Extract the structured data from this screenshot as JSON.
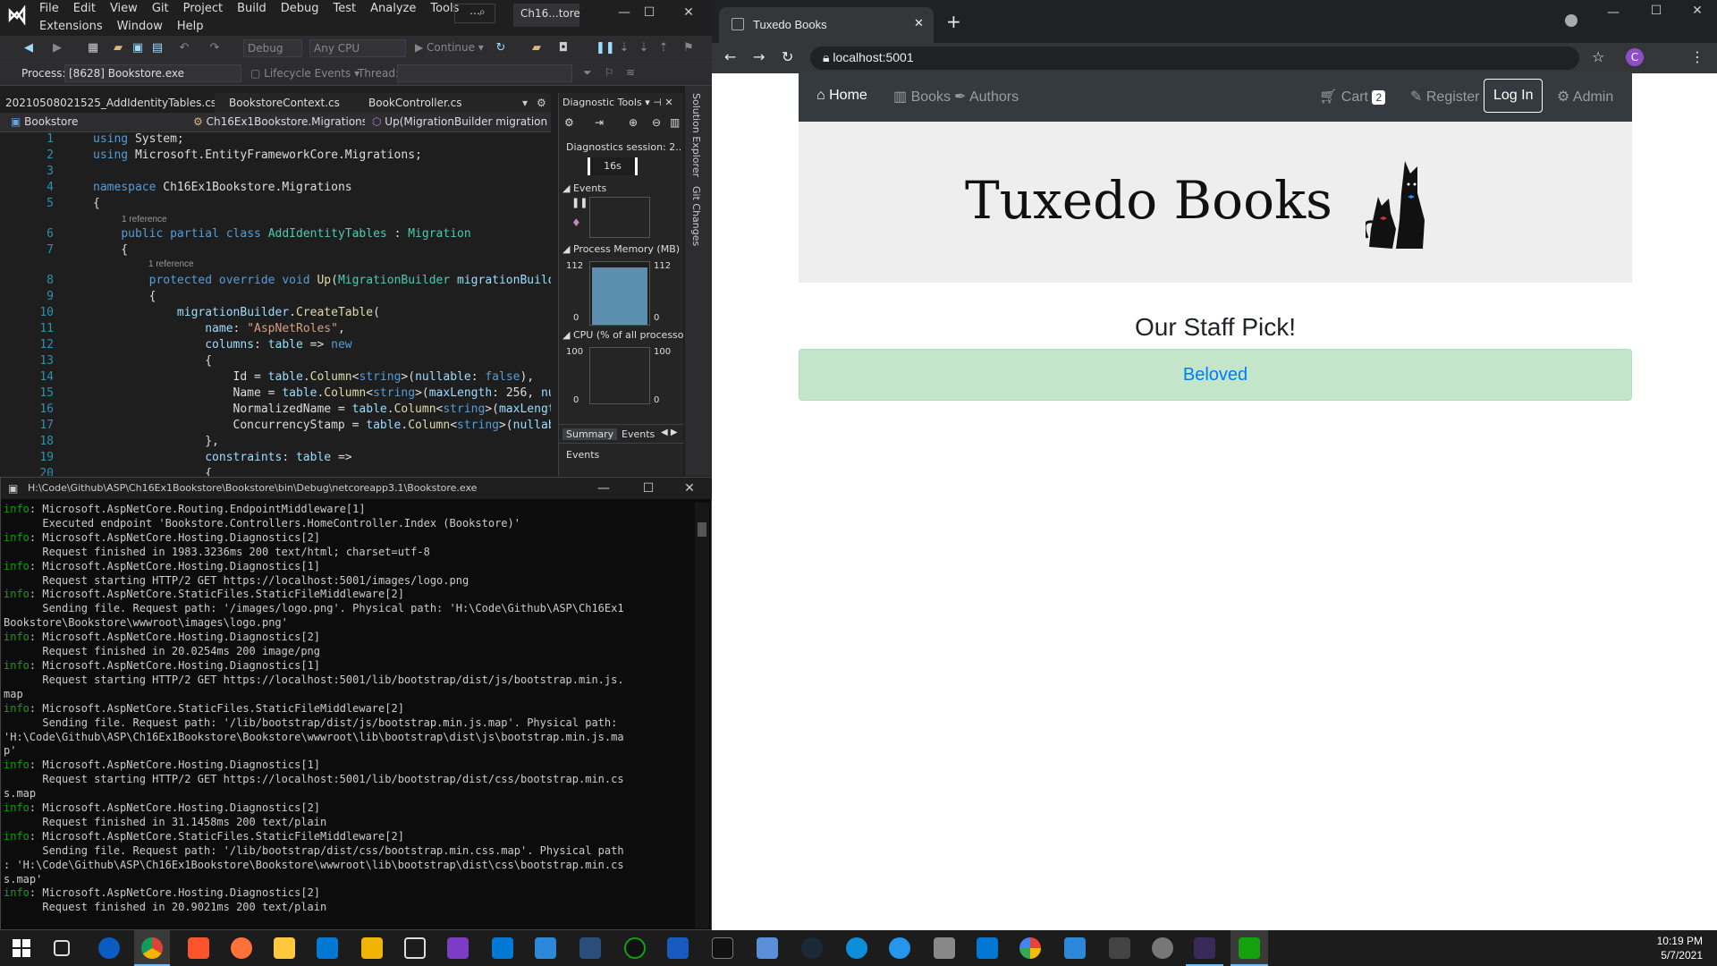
{
  "vs": {
    "menu_row1": [
      "File",
      "Edit",
      "View",
      "Git",
      "Project",
      "Build",
      "Debug",
      "Test",
      "Analyze",
      "Tools"
    ],
    "menu_row2": [
      "Extensions",
      "Window",
      "Help"
    ],
    "title": "Ch16...tore",
    "toolbar": {
      "config": "Debug",
      "platform": "Any CPU",
      "continue": "Continue"
    },
    "process_label": "Process:",
    "process_value": "[8628] Bookstore.exe",
    "lifecycle": "Lifecycle Events",
    "thread_label": "Thread:",
    "tabs": [
      "20210508021525_AddIdentityTables.cs",
      "BookstoreContext.cs",
      "BookController.cs"
    ],
    "nav_project": "Bookstore",
    "nav_class": "Ch16Ex1Bookstore.Migrations.A",
    "nav_member": "Up(MigrationBuilder migrationI",
    "line_numbers": [
      "1",
      "2",
      "3",
      "4",
      "5",
      "6",
      "7",
      "8",
      "9",
      "10",
      "11",
      "12",
      "13",
      "14",
      "15",
      "16",
      "17",
      "18",
      "19",
      "20"
    ],
    "ref_label": "1 reference"
  },
  "diag": {
    "title": "Diagnostic Tools",
    "session": "Diagnostics session: 2...",
    "time": "16s",
    "events": "Events",
    "memory": "Process Memory (MB)",
    "mem_max": "112",
    "mem_min": "0",
    "cpu": "CPU (% of all processo",
    "cpu_max": "100",
    "cpu_min": "0",
    "tab_summary": "Summary",
    "tab_events": "Events",
    "events_footer": "Events"
  },
  "side_tabs": [
    "Solution Explorer",
    "Git Changes"
  ],
  "console": {
    "title": "H:\\Code\\Github\\ASP\\Ch16Ex1Bookstore\\Bookstore\\bin\\Debug\\netcoreapp3.1\\Bookstore.exe",
    "lines": [
      [
        "info",
        ": Microsoft.AspNetCore.Routing.EndpointMiddleware[1]"
      ],
      [
        "",
        "      Executed endpoint 'Bookstore.Controllers.HomeController.Index (Bookstore)'"
      ],
      [
        "info",
        ": Microsoft.AspNetCore.Hosting.Diagnostics[2]"
      ],
      [
        "",
        "      Request finished in 1983.3236ms 200 text/html; charset=utf-8"
      ],
      [
        "info",
        ": Microsoft.AspNetCore.Hosting.Diagnostics[1]"
      ],
      [
        "",
        "      Request starting HTTP/2 GET https://localhost:5001/images/logo.png"
      ],
      [
        "info",
        ": Microsoft.AspNetCore.StaticFiles.StaticFileMiddleware[2]"
      ],
      [
        "",
        "      Sending file. Request path: '/images/logo.png'. Physical path: 'H:\\Code\\Github\\ASP\\Ch16Ex1"
      ],
      [
        "",
        "Bookstore\\Bookstore\\wwwroot\\images\\logo.png'"
      ],
      [
        "info",
        ": Microsoft.AspNetCore.Hosting.Diagnostics[2]"
      ],
      [
        "",
        "      Request finished in 20.0254ms 200 image/png"
      ],
      [
        "info",
        ": Microsoft.AspNetCore.Hosting.Diagnostics[1]"
      ],
      [
        "",
        "      Request starting HTTP/2 GET https://localhost:5001/lib/bootstrap/dist/js/bootstrap.min.js."
      ],
      [
        "",
        "map"
      ],
      [
        "info",
        ": Microsoft.AspNetCore.StaticFiles.StaticFileMiddleware[2]"
      ],
      [
        "",
        "      Sending file. Request path: '/lib/bootstrap/dist/js/bootstrap.min.js.map'. Physical path:"
      ],
      [
        "",
        "'H:\\Code\\Github\\ASP\\Ch16Ex1Bookstore\\Bookstore\\wwwroot\\lib\\bootstrap\\dist\\js\\bootstrap.min.js.ma"
      ],
      [
        "",
        "p'"
      ],
      [
        "info",
        ": Microsoft.AspNetCore.Hosting.Diagnostics[1]"
      ],
      [
        "",
        "      Request starting HTTP/2 GET https://localhost:5001/lib/bootstrap/dist/css/bootstrap.min.cs"
      ],
      [
        "",
        "s.map"
      ],
      [
        "info",
        ": Microsoft.AspNetCore.Hosting.Diagnostics[2]"
      ],
      [
        "",
        "      Request finished in 31.1458ms 200 text/plain"
      ],
      [
        "info",
        ": Microsoft.AspNetCore.StaticFiles.StaticFileMiddleware[2]"
      ],
      [
        "",
        "      Sending file. Request path: '/lib/bootstrap/dist/css/bootstrap.min.css.map'. Physical path"
      ],
      [
        "",
        ": 'H:\\Code\\Github\\ASP\\Ch16Ex1Bookstore\\Bookstore\\wwwroot\\lib\\bootstrap\\dist\\css\\bootstrap.min.cs"
      ],
      [
        "",
        "s.map'"
      ],
      [
        "info",
        ": Microsoft.AspNetCore.Hosting.Diagnostics[2]"
      ],
      [
        "",
        "      Request finished in 20.9021ms 200 text/plain"
      ]
    ]
  },
  "browser": {
    "tab_title": "Tuxedo Books",
    "url": "localhost:5001",
    "profile_initial": "C",
    "nav": {
      "home": "Home",
      "books": "Books",
      "authors": "Authors",
      "cart": "Cart",
      "cart_count": "2",
      "register": "Register",
      "login": "Log In",
      "admin": "Admin"
    },
    "logo_text": "Tuxedo Books",
    "heading": "Our Staff Pick!",
    "pick": "Beloved"
  },
  "taskbar": {
    "time": "10:19 PM",
    "date": "5/7/2021"
  }
}
